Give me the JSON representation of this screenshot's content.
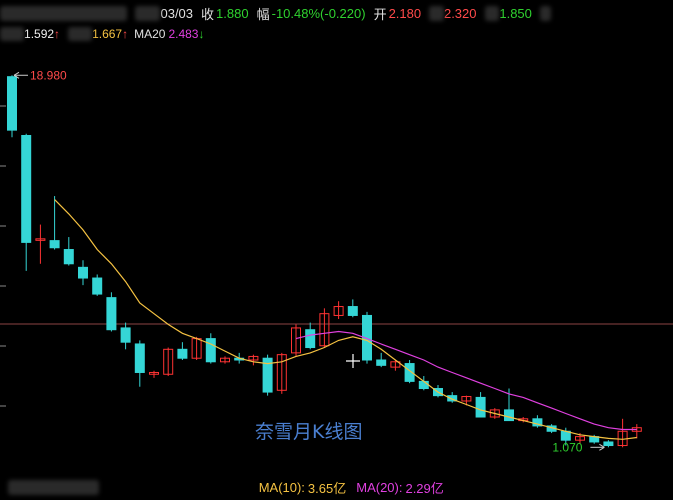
{
  "header": {
    "date": "03/03",
    "close_label": "收",
    "close_value": "1.880",
    "change_label": "幅",
    "change_value": "-10.48%(-0.220)",
    "open_label": "开",
    "open_value": "2.180",
    "high_value": "2.320",
    "low_value": "1.850"
  },
  "ma_bar": {
    "ma5_value": "1.592",
    "ma10_value": "1.667",
    "ma20_label": "MA20",
    "ma20_value": "2.483"
  },
  "chart_data": {
    "type": "candlestick",
    "title": "",
    "watermark": "奈雪月K线图",
    "high_annotation": "18.980",
    "low_annotation": "1.070",
    "colors": {
      "up": "#ff3333",
      "down": "#35d6d6",
      "ma10": "#f5c242",
      "ma20": "#e040e0",
      "grid": "#c86060"
    },
    "ylim": [
      0,
      20
    ],
    "candles": [
      {
        "o": 18.9,
        "h": 18.98,
        "l": 15.5,
        "c": 15.9
      },
      {
        "o": 15.6,
        "h": 15.7,
        "l": 8.0,
        "c": 9.6
      },
      {
        "o": 9.8,
        "h": 10.6,
        "l": 8.4,
        "c": 9.8
      },
      {
        "o": 9.7,
        "h": 12.2,
        "l": 9.2,
        "c": 9.3
      },
      {
        "o": 9.2,
        "h": 9.9,
        "l": 8.3,
        "c": 8.4
      },
      {
        "o": 8.2,
        "h": 8.6,
        "l": 7.2,
        "c": 7.6
      },
      {
        "o": 7.6,
        "h": 7.8,
        "l": 6.6,
        "c": 6.7
      },
      {
        "o": 6.5,
        "h": 6.8,
        "l": 4.6,
        "c": 4.7
      },
      {
        "o": 4.8,
        "h": 5.1,
        "l": 3.6,
        "c": 4.0
      },
      {
        "o": 3.9,
        "h": 4.1,
        "l": 1.5,
        "c": 2.3
      },
      {
        "o": 2.2,
        "h": 2.4,
        "l": 2.0,
        "c": 2.3
      },
      {
        "o": 2.2,
        "h": 3.7,
        "l": 2.1,
        "c": 3.6
      },
      {
        "o": 3.6,
        "h": 4.0,
        "l": 3.0,
        "c": 3.1
      },
      {
        "o": 3.1,
        "h": 4.3,
        "l": 3.0,
        "c": 4.2
      },
      {
        "o": 4.2,
        "h": 4.5,
        "l": 2.8,
        "c": 2.9
      },
      {
        "o": 2.9,
        "h": 3.2,
        "l": 2.8,
        "c": 3.1
      },
      {
        "o": 3.1,
        "h": 3.4,
        "l": 2.8,
        "c": 3.0
      },
      {
        "o": 3.0,
        "h": 3.3,
        "l": 2.7,
        "c": 3.2
      },
      {
        "o": 3.1,
        "h": 3.3,
        "l": 1.0,
        "c": 1.2
      },
      {
        "o": 1.3,
        "h": 3.4,
        "l": 1.1,
        "c": 3.3
      },
      {
        "o": 3.4,
        "h": 5.0,
        "l": 3.2,
        "c": 4.8
      },
      {
        "o": 4.7,
        "h": 5.1,
        "l": 3.6,
        "c": 3.7
      },
      {
        "o": 3.8,
        "h": 5.9,
        "l": 3.7,
        "c": 5.6
      },
      {
        "o": 5.5,
        "h": 6.3,
        "l": 5.3,
        "c": 6.0
      },
      {
        "o": 6.0,
        "h": 6.4,
        "l": 5.4,
        "c": 5.5
      },
      {
        "o": 5.5,
        "h": 5.7,
        "l": 2.8,
        "c": 3.0
      },
      {
        "o": 3.0,
        "h": 3.4,
        "l": 2.6,
        "c": 2.7
      },
      {
        "o": 2.6,
        "h": 3.0,
        "l": 2.4,
        "c": 2.9
      },
      {
        "o": 2.8,
        "h": 3.0,
        "l": 1.7,
        "c": 1.8
      },
      {
        "o": 1.8,
        "h": 2.1,
        "l": 1.3,
        "c": 1.4
      },
      {
        "o": 1.4,
        "h": 1.6,
        "l": 0.9,
        "c": 1.0
      },
      {
        "o": 1.0,
        "h": 1.2,
        "l": 0.6,
        "c": 0.7
      },
      {
        "o": 0.7,
        "h": 1.0,
        "l": 0.45,
        "c": 0.95
      },
      {
        "o": 0.9,
        "h": 1.2,
        "l": 0.15,
        "c": -0.2
      },
      {
        "o": -0.2,
        "h": 0.3,
        "l": -0.3,
        "c": 0.2
      },
      {
        "o": 0.2,
        "h": 1.4,
        "l": 0.0,
        "c": -0.4
      },
      {
        "o": -0.4,
        "h": -0.2,
        "l": -0.5,
        "c": -0.3
      },
      {
        "o": -0.3,
        "h": -0.1,
        "l": -0.8,
        "c": -0.7
      },
      {
        "o": -0.7,
        "h": -0.6,
        "l": -1.1,
        "c": -1.0
      },
      {
        "o": -1.0,
        "h": -0.8,
        "l": -1.8,
        "c": -1.5
      },
      {
        "o": -1.5,
        "h": -1.1,
        "l": -1.7,
        "c": -1.3
      },
      {
        "o": -1.3,
        "h": -1.2,
        "l": -1.7,
        "c": -1.6
      },
      {
        "o": -1.6,
        "h": -1.5,
        "l": -1.9,
        "c": -1.8
      },
      {
        "o": -1.8,
        "h": -0.3,
        "l": -1.9,
        "c": -1.0
      },
      {
        "o": -1.0,
        "h": -0.6,
        "l": -1.4,
        "c": -0.8
      }
    ],
    "ma10": [
      null,
      null,
      null,
      12.0,
      11.2,
      10.3,
      9.2,
      8.4,
      7.4,
      6.2,
      5.6,
      5.0,
      4.5,
      4.2,
      3.9,
      3.5,
      3.1,
      2.9,
      2.8,
      2.9,
      3.2,
      3.4,
      3.7,
      4.1,
      4.3,
      4.1,
      3.6,
      3.0,
      2.4,
      1.8,
      1.2,
      0.8,
      0.5,
      0.2,
      0.0,
      -0.2,
      -0.4,
      -0.6,
      -0.8,
      -1.0,
      -1.2,
      -1.3,
      -1.4,
      -1.45,
      -1.35
    ],
    "ma20": [
      null,
      null,
      null,
      null,
      null,
      null,
      null,
      null,
      null,
      null,
      null,
      null,
      null,
      null,
      null,
      null,
      null,
      null,
      null,
      null,
      4.2,
      4.4,
      4.5,
      4.6,
      4.5,
      4.2,
      3.9,
      3.6,
      3.3,
      3.0,
      2.6,
      2.3,
      2.0,
      1.7,
      1.4,
      1.1,
      0.9,
      0.6,
      0.3,
      0.0,
      -0.3,
      -0.6,
      -0.8,
      -0.9,
      -0.9
    ]
  },
  "footer": {
    "ma10_label": "MA(10):",
    "ma10_value": "3.65亿",
    "ma20_label": "MA(20):",
    "ma20_value": "2.29亿"
  }
}
